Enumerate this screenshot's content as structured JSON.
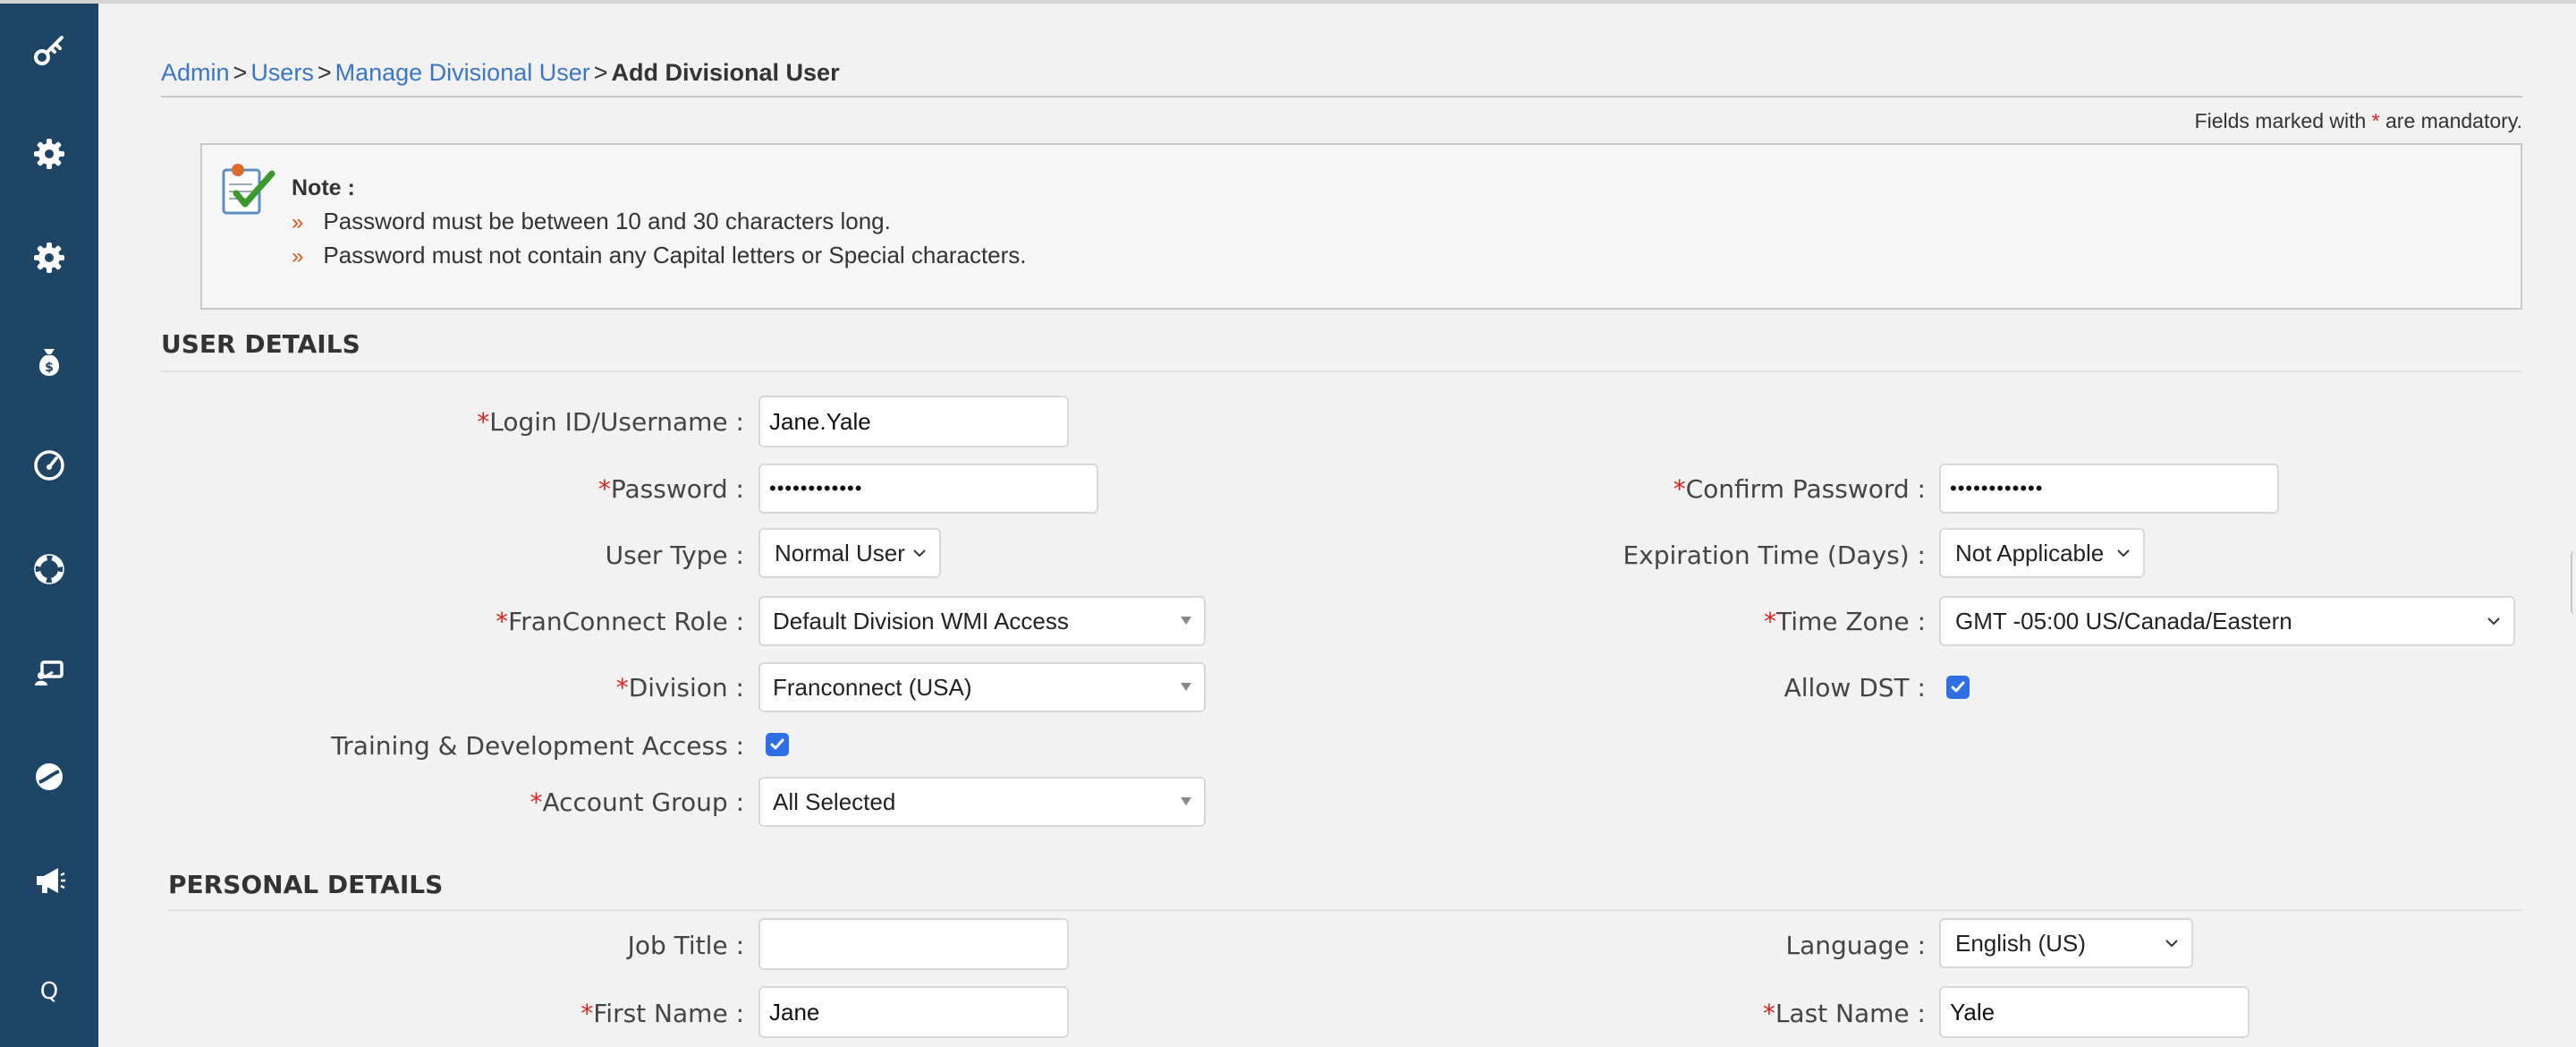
{
  "sidebar": {
    "icons": [
      "key-icon",
      "gear-icon",
      "gear-icon",
      "money-bag-icon",
      "dashboard-icon",
      "lifebuoy-icon",
      "training-icon",
      "sphere-icon",
      "megaphone-icon",
      "q-icon"
    ],
    "q_label": "Q"
  },
  "breadcrumb": {
    "items": [
      "Admin",
      "Users",
      "Manage Divisional User"
    ],
    "separator": ">",
    "current": "Add Divisional User"
  },
  "mandatory": {
    "prefix": "Fields marked with",
    "mark": "*",
    "suffix": "are mandatory."
  },
  "note": {
    "title": "Note :",
    "bullet": "»",
    "items": [
      "Password must be between 10 and 30 characters long.",
      "Password must not contain any Capital letters or Special characters."
    ]
  },
  "user_details": {
    "heading": "USER DETAILS",
    "req_mark": "*",
    "login_label": "Login ID/Username :",
    "login_value": "Jane.Yale",
    "password_label": "Password :",
    "password_value": "••••••••••••",
    "confirm_password_label": "Confirm Password :",
    "confirm_password_value": "••••••••••••",
    "user_type_label": "User Type :",
    "user_type_value": "Normal User",
    "expiration_label": "Expiration Time (Days) :",
    "expiration_value": "Not Applicable",
    "role_label": "FranConnect Role :",
    "role_value": "Default Division WMI Access",
    "timezone_label": "Time Zone :",
    "timezone_value": "GMT -05:00 US/Canada/Eastern",
    "division_label": "Division :",
    "division_value": "Franconnect (USA)",
    "allow_dst_label": "Allow DST :",
    "allow_dst_checked": true,
    "training_label": "Training & Development Access :",
    "training_checked": true,
    "account_group_label": "Account Group :",
    "account_group_value": "All Selected"
  },
  "personal_details": {
    "heading": "PERSONAL DETAILS",
    "req_mark": "*",
    "job_title_label": "Job Title :",
    "job_title_value": "",
    "language_label": "Language :",
    "language_value": "English (US)",
    "first_name_label": "First Name :",
    "first_name_value": "Jane",
    "last_name_label": "Last Name :",
    "last_name_value": "Yale"
  },
  "colors": {
    "sidebar": "#1e4466",
    "link": "#3a76c6",
    "required": "#dd2222",
    "checkbox": "#2f6fe4"
  }
}
